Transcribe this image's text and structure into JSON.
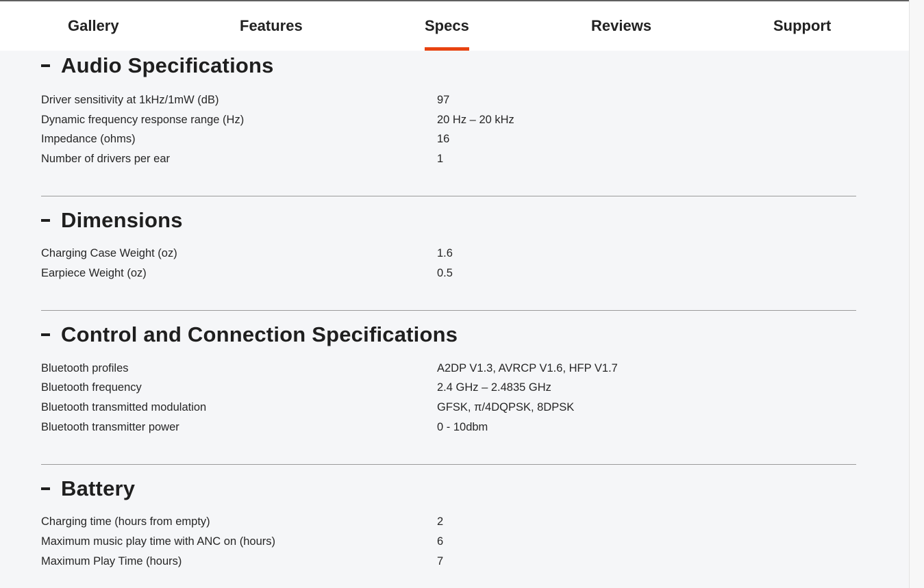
{
  "tabs": [
    {
      "label": "Gallery",
      "active": false
    },
    {
      "label": "Features",
      "active": false
    },
    {
      "label": "Specs",
      "active": true
    },
    {
      "label": "Reviews",
      "active": false
    },
    {
      "label": "Support",
      "active": false
    }
  ],
  "accent_color": "#e84310",
  "sections": [
    {
      "title": "Audio Specifications",
      "collapse_icon": "minus-icon",
      "rows": [
        {
          "label": "Driver sensitivity at 1kHz/1mW (dB)",
          "value": "97"
        },
        {
          "label": "Dynamic frequency response range (Hz)",
          "value": "20 Hz – 20 kHz"
        },
        {
          "label": "Impedance (ohms)",
          "value": "16"
        },
        {
          "label": "Number of drivers per ear",
          "value": "1"
        }
      ]
    },
    {
      "title": "Dimensions",
      "collapse_icon": "minus-icon",
      "rows": [
        {
          "label": "Charging Case Weight (oz)",
          "value": "1.6"
        },
        {
          "label": "Earpiece Weight (oz)",
          "value": "0.5"
        }
      ]
    },
    {
      "title": "Control and Connection Specifications",
      "collapse_icon": "minus-icon",
      "rows": [
        {
          "label": "Bluetooth profiles",
          "value": "A2DP V1.3, AVRCP V1.6, HFP V1.7"
        },
        {
          "label": "Bluetooth frequency",
          "value": "2.4 GHz – 2.4835 GHz"
        },
        {
          "label": "Bluetooth transmitted modulation",
          "value": "GFSK, π/4DQPSK, 8DPSK"
        },
        {
          "label": "Bluetooth transmitter power",
          "value": "0 - 10dbm"
        }
      ]
    },
    {
      "title": "Battery",
      "collapse_icon": "minus-icon",
      "rows": [
        {
          "label": "Charging time (hours from empty)",
          "value": "2"
        },
        {
          "label": "Maximum music play time with ANC on (hours)",
          "value": "6"
        },
        {
          "label": "Maximum Play Time (hours)",
          "value": "7"
        }
      ]
    }
  ]
}
